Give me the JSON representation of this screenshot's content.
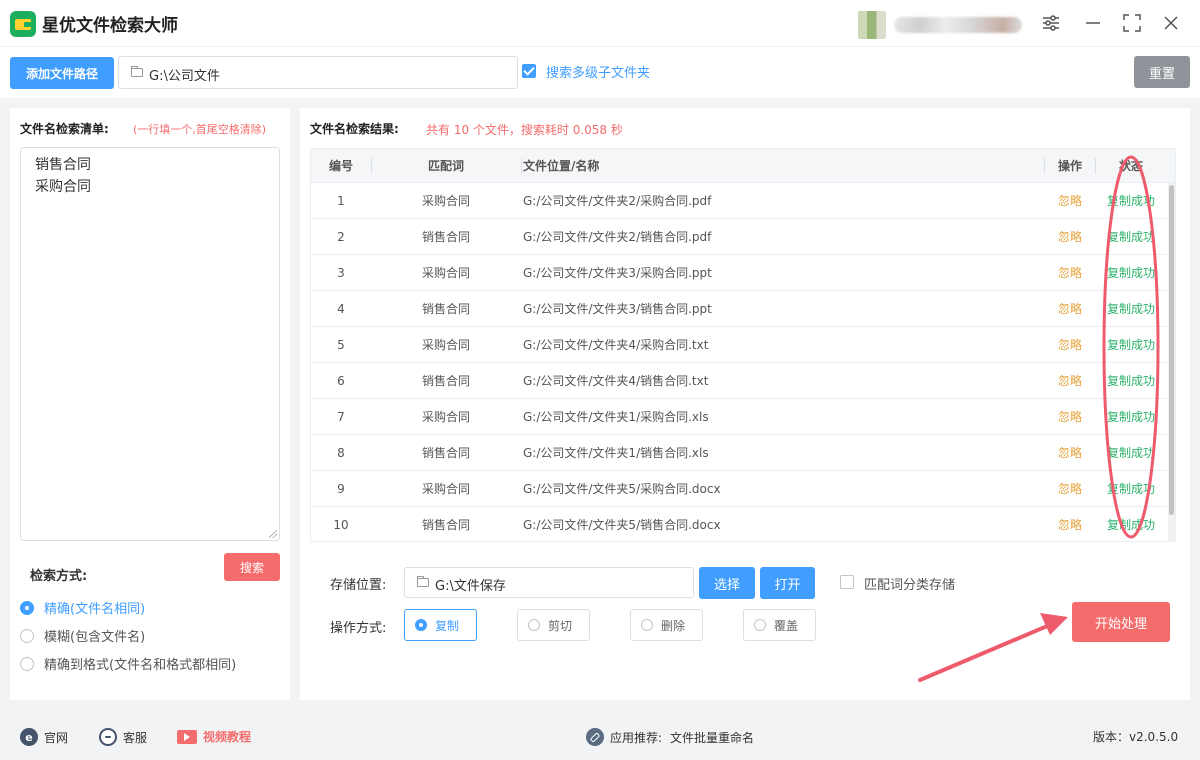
{
  "app": {
    "title": "星优文件检索大师"
  },
  "window": {
    "settings": "⚙",
    "minimize": "—",
    "maximize": "⛶",
    "close": "✕"
  },
  "toolbar": {
    "add_path_label": "添加文件路径",
    "path_value": "G:\\公司文件",
    "subfolder_checked": true,
    "subfolder_label": "搜索多级子文件夹",
    "reset_label": "重置"
  },
  "search_list": {
    "title": "文件名检索清单:",
    "hint": "(一行填一个,首尾空格清除)",
    "keywords": [
      "销售合同",
      "采购合同"
    ],
    "search_label": "搜索",
    "mode_title": "检索方式:",
    "modes": [
      {
        "label": "精确(文件名相同)",
        "selected": true
      },
      {
        "label": "模糊(包含文件名)",
        "selected": false
      },
      {
        "label": "精确到格式(文件名和格式都相同)",
        "selected": false
      }
    ]
  },
  "results": {
    "title": "文件名检索结果:",
    "summary": "共有 10 个文件，搜索耗时 0.058 秒",
    "columns": [
      "编号",
      "匹配词",
      "文件位置/名称",
      "操作",
      "状态"
    ],
    "rows": [
      {
        "no": "1",
        "keyword": "采购合同",
        "path": "G:/公司文件/文件夹2/采购合同.pdf",
        "op": "忽略",
        "status": "复制成功"
      },
      {
        "no": "2",
        "keyword": "销售合同",
        "path": "G:/公司文件/文件夹2/销售合同.pdf",
        "op": "忽略",
        "status": "复制成功"
      },
      {
        "no": "3",
        "keyword": "采购合同",
        "path": "G:/公司文件/文件夹3/采购合同.ppt",
        "op": "忽略",
        "status": "复制成功"
      },
      {
        "no": "4",
        "keyword": "销售合同",
        "path": "G:/公司文件/文件夹3/销售合同.ppt",
        "op": "忽略",
        "status": "复制成功"
      },
      {
        "no": "5",
        "keyword": "采购合同",
        "path": "G:/公司文件/文件夹4/采购合同.txt",
        "op": "忽略",
        "status": "复制成功"
      },
      {
        "no": "6",
        "keyword": "销售合同",
        "path": "G:/公司文件/文件夹4/销售合同.txt",
        "op": "忽略",
        "status": "复制成功"
      },
      {
        "no": "7",
        "keyword": "采购合同",
        "path": "G:/公司文件/文件夹1/采购合同.xls",
        "op": "忽略",
        "status": "复制成功"
      },
      {
        "no": "8",
        "keyword": "销售合同",
        "path": "G:/公司文件/文件夹1/销售合同.xls",
        "op": "忽略",
        "status": "复制成功"
      },
      {
        "no": "9",
        "keyword": "采购合同",
        "path": "G:/公司文件/文件夹5/采购合同.docx",
        "op": "忽略",
        "status": "复制成功"
      },
      {
        "no": "10",
        "keyword": "销售合同",
        "path": "G:/公司文件/文件夹5/销售合同.docx",
        "op": "忽略",
        "status": "复制成功"
      }
    ]
  },
  "output": {
    "store_label": "存储位置:",
    "store_path": "G:\\文件保存",
    "choose_label": "选择",
    "open_label": "打开",
    "classify_label": "匹配词分类存储",
    "op_label": "操作方式:",
    "ops": [
      {
        "label": "复制",
        "selected": true
      },
      {
        "label": "剪切",
        "selected": false
      },
      {
        "label": "删除",
        "selected": false
      },
      {
        "label": "覆盖",
        "selected": false
      }
    ],
    "start_label": "开始处理"
  },
  "footer": {
    "website": "官网",
    "service": "客服",
    "video": "视频教程",
    "recommend_label": "应用推荐:",
    "recommend_app": "文件批量重命名",
    "version": "版本：v2.0.5.0"
  },
  "colors": {
    "accent": "#3f9eff",
    "danger": "#f56c6c",
    "success": "#2db36b",
    "warning": "#e6a23c"
  }
}
